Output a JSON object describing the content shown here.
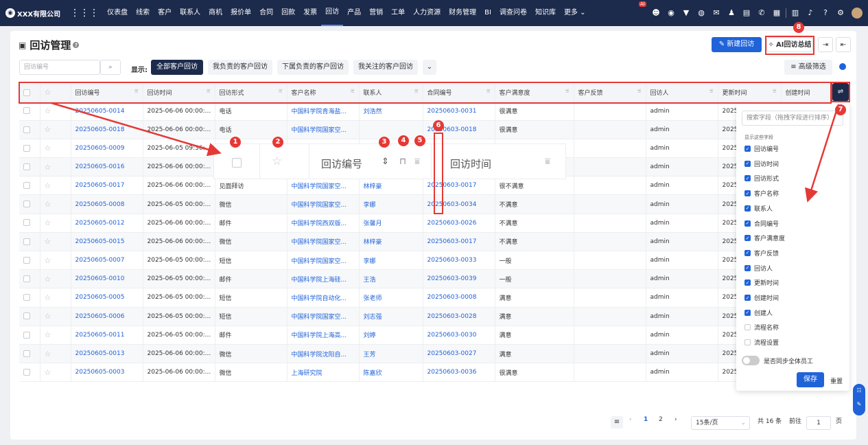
{
  "brand": {
    "name": "XXX有限公司"
  },
  "nav": [
    "仪表盘",
    "线索",
    "客户",
    "联系人",
    "商机",
    "报价单",
    "合同",
    "回款",
    "发票",
    "回访",
    "产品",
    "营销",
    "工单",
    "人力资源",
    "财务管理",
    "BI",
    "调查问卷",
    "知识库",
    "更多 ⌄"
  ],
  "nav_active": "回访",
  "ai_badge": "AI",
  "page": {
    "title": "回访管理",
    "new_button": "新建回访",
    "ai_button": "AI回访总结",
    "search_placeholder": "回访编号",
    "show_label": "显示:",
    "filters": [
      "全部客户回访",
      "我负责的客户回访",
      "下属负责的客户回访",
      "我关注的客户回访"
    ],
    "adv_filter": "高级筛选"
  },
  "table": {
    "headers": [
      "回访编号",
      "回访时间",
      "回访形式",
      "客户名称",
      "联系人",
      "合同编号",
      "客户满意度",
      "客户反馈",
      "回访人",
      "更新时间",
      "创建时间"
    ],
    "rows": [
      [
        "20250605-0014",
        "2025-06-06 00:00:...",
        "电话",
        "中国科学院青海盐...",
        "刘浩然",
        "20250603-0031",
        "很满意",
        "",
        "admin",
        "2025-"
      ],
      [
        "20250605-0018",
        "2025-06-06 00:00:...",
        "电话",
        "中国科学院国家空...",
        "",
        "20250603-0018",
        "很满意",
        "",
        "admin",
        "2025-"
      ],
      [
        "20250605-0009",
        "2025-06-05 09:36:...",
        "",
        "",
        "",
        "",
        "",
        "",
        "admin",
        "2025-"
      ],
      [
        "20250605-0016",
        "2025-06-06 00:00:...",
        "",
        "",
        "",
        "",
        "",
        "",
        "admin",
        "2025-"
      ],
      [
        "20250605-0017",
        "2025-06-06 00:00:...",
        "见面拜访",
        "中国科学院国家空...",
        "林梓豪",
        "20250603-0017",
        "很不满意",
        "",
        "admin",
        "2025-"
      ],
      [
        "20250605-0008",
        "2025-06-05 00:00:...",
        "微信",
        "中国科学院国家空...",
        "李娜",
        "20250603-0034",
        "不满意",
        "",
        "admin",
        "2025-"
      ],
      [
        "20250605-0012",
        "2025-06-06 00:00:...",
        "邮件",
        "中国科学院西双版...",
        "张馨月",
        "20250603-0026",
        "不满意",
        "",
        "admin",
        "2025-"
      ],
      [
        "20250605-0015",
        "2025-06-06 00:00:...",
        "微信",
        "中国科学院国家空...",
        "林梓豪",
        "20250603-0017",
        "不满意",
        "",
        "admin",
        "2025-"
      ],
      [
        "20250605-0007",
        "2025-06-05 00:00:...",
        "短信",
        "中国科学院国家空...",
        "李娜",
        "20250603-0033",
        "一般",
        "",
        "admin",
        "2025-"
      ],
      [
        "20250605-0010",
        "2025-06-05 00:00:...",
        "邮件",
        "中国科学院上海硅...",
        "王浩",
        "20250603-0039",
        "一般",
        "",
        "admin",
        "2025-"
      ],
      [
        "20250605-0005",
        "2025-06-05 00:00:...",
        "短信",
        "中国科学院自动化...",
        "张老师",
        "20250603-0008",
        "满意",
        "",
        "admin",
        "2025-"
      ],
      [
        "20250605-0006",
        "2025-06-05 00:00:...",
        "短信",
        "中国科学院国家空...",
        "刘志强",
        "20250603-0028",
        "满意",
        "",
        "admin",
        "2025-"
      ],
      [
        "20250605-0011",
        "2025-06-05 00:00:...",
        "邮件",
        "中国科学院上海高...",
        "刘婷",
        "20250603-0030",
        "满意",
        "",
        "admin",
        "2025-"
      ],
      [
        "20250605-0013",
        "2025-06-06 00:00:...",
        "微信",
        "中国科学院沈阳自...",
        "王芳",
        "20250603-0027",
        "满意",
        "",
        "admin",
        "2025-"
      ],
      [
        "20250605-0003",
        "2025-06-06 00:00:...",
        "微信",
        "上海研究院",
        "陈嘉欣",
        "20250603-0036",
        "很满意",
        "",
        "admin",
        "2025-"
      ]
    ]
  },
  "zoom": {
    "col1": "回访编号",
    "col2": "回访时间"
  },
  "labels": [
    "1",
    "2",
    "3",
    "4",
    "5",
    "6",
    "7",
    "8"
  ],
  "panel": {
    "search": "搜索字段（拖拽字段进行排序）",
    "caption": "显示这些字段",
    "fields": [
      {
        "label": "回访编号",
        "on": true
      },
      {
        "label": "回访时间",
        "on": true
      },
      {
        "label": "回访形式",
        "on": true
      },
      {
        "label": "客户名称",
        "on": true
      },
      {
        "label": "联系人",
        "on": true
      },
      {
        "label": "合同编号",
        "on": true
      },
      {
        "label": "客户满意度",
        "on": true
      },
      {
        "label": "客户反馈",
        "on": true
      },
      {
        "label": "回访人",
        "on": true
      },
      {
        "label": "更新时间",
        "on": true
      },
      {
        "label": "创建时间",
        "on": true
      },
      {
        "label": "创建人",
        "on": true
      },
      {
        "label": "流程名称",
        "on": false
      },
      {
        "label": "流程设置",
        "on": false
      }
    ],
    "sync": "是否同步全体员工",
    "save": "保存",
    "reset": "重置"
  },
  "pager": {
    "page1": "1",
    "page2": "2",
    "size": "15条/页",
    "total": "共 16 条",
    "goto": "前往",
    "goto_value": "1",
    "page_unit": "页"
  },
  "colors": {
    "nav": "#1c2a4b",
    "primary": "#2063d9",
    "annot": "#e53935"
  }
}
